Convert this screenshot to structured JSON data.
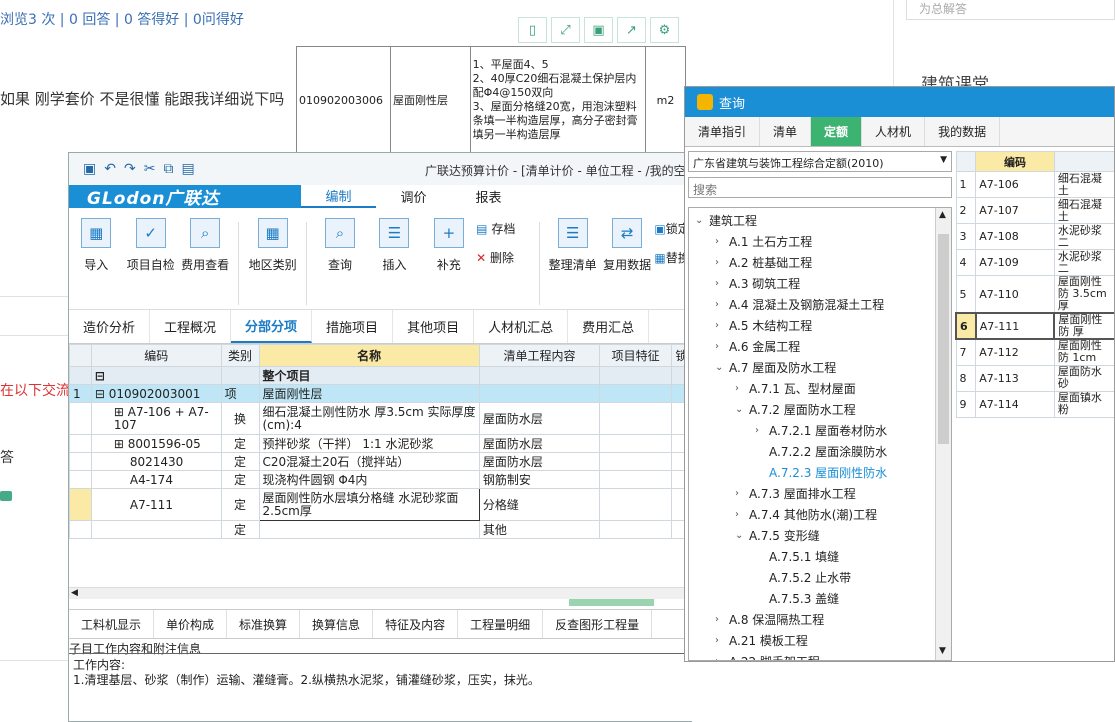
{
  "forum": {
    "stats": "浏览3 次 | 0 回答 | 0 答得好 | 0问得好",
    "question": "如果 刚学套价 不是很懂 能跟我详细说下吗",
    "red_text": "在以下交流",
    "left_char": "答",
    "side_title": "建筑课堂",
    "side_block_text": "为总解答"
  },
  "toolbar_icons": [
    "mobile-icon",
    "expand-icon",
    "save-icon",
    "share-icon",
    "gear-icon"
  ],
  "spec_table": {
    "code": "010902003006",
    "name": "屋面刚性层",
    "desc_lines": [
      "1、平屋面4、5",
      "2、40厚C20细石混凝土保护层内配Φ4@150双向",
      "3、屋面分格缝20宽，用泡沫塑料条填一半构造层厚，高分子密封膏填另一半构造层厚"
    ],
    "unit": "m2"
  },
  "gld": {
    "title": "广联达预算计价 - [清单计价 - 单位工程 - /我的空",
    "logo": "GLodon广联达",
    "menu": [
      "编制",
      "调价",
      "报表"
    ],
    "ribbon": [
      "导入",
      "项目自检",
      "费用查看",
      "地区类别",
      "查询",
      "插入",
      "补充"
    ],
    "small_buttons": [
      "存档",
      "删除"
    ],
    "ribbon_right": [
      "整理清单",
      "复用数据"
    ],
    "ribbon_far": [
      "锁定",
      "替换"
    ],
    "subtabs": [
      "造价分析",
      "工程概况",
      "分部分项",
      "措施项目",
      "其他项目",
      "人材机汇总",
      "费用汇总"
    ],
    "grid_headers": [
      "编码",
      "类别",
      "名称",
      "清单工程内容",
      "项目特征",
      "锁"
    ],
    "rows": [
      {
        "num": "",
        "code": "",
        "type": "",
        "name": "整个项目",
        "content": ""
      },
      {
        "num": "1",
        "code": "010902003001",
        "type": "项",
        "name": "屋面刚性层",
        "content": ""
      },
      {
        "num": "",
        "code": "A7-106 + A7-107",
        "type": "换",
        "name": "细石混凝土刚性防水 厚3.5cm  实际厚度(cm):4",
        "content": "屋面防水层"
      },
      {
        "num": "",
        "code": "8001596-05",
        "type": "定",
        "name": "预拌砂浆（干拌） 1:1 水泥砂浆",
        "content": "屋面防水层"
      },
      {
        "num": "",
        "code": "8021430",
        "type": "定",
        "name": "C20混凝土20石（搅拌站）",
        "content": "屋面防水层"
      },
      {
        "num": "",
        "code": "A4-174",
        "type": "定",
        "name": "现浇构件圆钢 Φ4内",
        "content": "钢筋制安"
      },
      {
        "num": "",
        "code": "A7-111",
        "type": "定",
        "name": "屋面刚性防水层填分格缝 水泥砂浆面2.5cm厚",
        "content": "分格缝"
      },
      {
        "num": "",
        "code": "",
        "type": "定",
        "name": "",
        "content": "其他"
      }
    ],
    "bottom_tabs": [
      "工料机显示",
      "单价构成",
      "标准换算",
      "换算信息",
      "特征及内容",
      "工程量明细",
      "反查图形工程量"
    ],
    "work_title": "子目工作内容和附注信息",
    "work_label": "工作内容:",
    "work_text": "1.清理基层、砂浆（制作）运输、灌缝膏。2.纵横热水泥浆，铺灌缝砂浆，压实，抹光。"
  },
  "query": {
    "title": "查询",
    "tabs": [
      "清单指引",
      "清单",
      "定额",
      "人材机",
      "我的数据"
    ],
    "active_tab": "定额",
    "dropdown": "广东省建筑与装饰工程综合定额(2010)",
    "search_placeholder": "搜索",
    "tree": [
      {
        "label": "建筑工程",
        "level": 0,
        "arrow": "v"
      },
      {
        "label": "A.1 土石方工程",
        "level": 1,
        "arrow": ">"
      },
      {
        "label": "A.2 桩基础工程",
        "level": 1,
        "arrow": ">"
      },
      {
        "label": "A.3 砌筑工程",
        "level": 1,
        "arrow": ">"
      },
      {
        "label": "A.4 混凝土及钢筋混凝土工程",
        "level": 1,
        "arrow": ">"
      },
      {
        "label": "A.5 木结构工程",
        "level": 1,
        "arrow": ">"
      },
      {
        "label": "A.6 金属工程",
        "level": 1,
        "arrow": ">"
      },
      {
        "label": "A.7 屋面及防水工程",
        "level": 1,
        "arrow": "v"
      },
      {
        "label": "A.7.1 瓦、型材屋面",
        "level": 2,
        "arrow": ">"
      },
      {
        "label": "A.7.2 屋面防水工程",
        "level": 2,
        "arrow": "v"
      },
      {
        "label": "A.7.2.1 屋面卷材防水",
        "level": 3,
        "arrow": ">"
      },
      {
        "label": "A.7.2.2 屋面涂膜防水",
        "level": 3,
        "arrow": ""
      },
      {
        "label": "A.7.2.3 屋面刚性防水",
        "level": 3,
        "arrow": "",
        "hl": true
      },
      {
        "label": "A.7.3 屋面排水工程",
        "level": 2,
        "arrow": ">"
      },
      {
        "label": "A.7.4 其他防水(潮)工程",
        "level": 2,
        "arrow": ">"
      },
      {
        "label": "A.7.5 变形缝",
        "level": 2,
        "arrow": "v"
      },
      {
        "label": "A.7.5.1 填缝",
        "level": 3,
        "arrow": ""
      },
      {
        "label": "A.7.5.2 止水带",
        "level": 3,
        "arrow": ""
      },
      {
        "label": "A.7.5.3 盖缝",
        "level": 3,
        "arrow": ""
      },
      {
        "label": "A.8 保温隔热工程",
        "level": 1,
        "arrow": ">"
      },
      {
        "label": "A.21 模板工程",
        "level": 1,
        "arrow": ">"
      },
      {
        "label": "A.22 脚手架工程",
        "level": 1,
        "arrow": ">"
      }
    ],
    "right_header": "编码",
    "right_rows": [
      {
        "n": "1",
        "code": "A7-106",
        "name": "细石混凝土"
      },
      {
        "n": "2",
        "code": "A7-107",
        "name": "细石混凝土"
      },
      {
        "n": "3",
        "code": "A7-108",
        "name": "水泥砂浆二"
      },
      {
        "n": "4",
        "code": "A7-109",
        "name": "水泥砂浆二"
      },
      {
        "n": "5",
        "code": "A7-110",
        "name": "屋面刚性防 3.5cm厚"
      },
      {
        "n": "6",
        "code": "A7-111",
        "name": "屋面刚性防 厚"
      },
      {
        "n": "7",
        "code": "A7-112",
        "name": "屋面刚性防 1cm"
      },
      {
        "n": "8",
        "code": "A7-113",
        "name": "屋面防水砂"
      },
      {
        "n": "9",
        "code": "A7-114",
        "name": "屋面镇水粉"
      }
    ]
  }
}
